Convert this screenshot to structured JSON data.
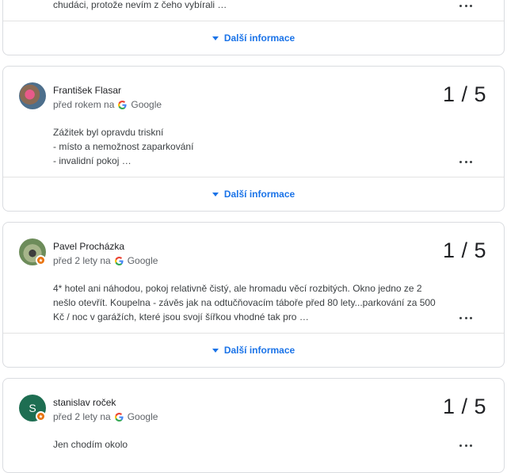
{
  "more_info_label": "Další informace",
  "source": "Google",
  "top_card": {
    "snippet": "chudáci, protože nevím z čeho vybírali …"
  },
  "reviews": [
    {
      "author": "František Flasar",
      "time": "před rokem na",
      "rating": "1 / 5",
      "lines": [
        "Zážitek byl opravdu triskní",
        "- místo a nemožnost zaparkování",
        "- invalidní pokoj …"
      ]
    },
    {
      "author": "Pavel Procházka",
      "time": "před 2 lety na",
      "rating": "1 / 5",
      "lines": [
        "4* hotel ani náhodou, pokoj relativně čistý, ale hromadu věcí rozbitých. Okno jedno ze 2",
        "nešlo otevřít. Koupelna - závěs jak na odtučňovacím táboře před 80 lety...parkování za 500",
        "Kč / noc v garážích, které jsou svojí šířkou vhodné tak pro …"
      ]
    },
    {
      "author": "stanislav roček",
      "time": "před 2 lety na",
      "rating": "1 / 5",
      "avatar_initial": "S",
      "lines": [
        "Jen chodím okolo"
      ]
    }
  ],
  "colors": {
    "link": "#1a73e8",
    "avatar_green": "#1e6e52",
    "badge": "#e8710a"
  }
}
